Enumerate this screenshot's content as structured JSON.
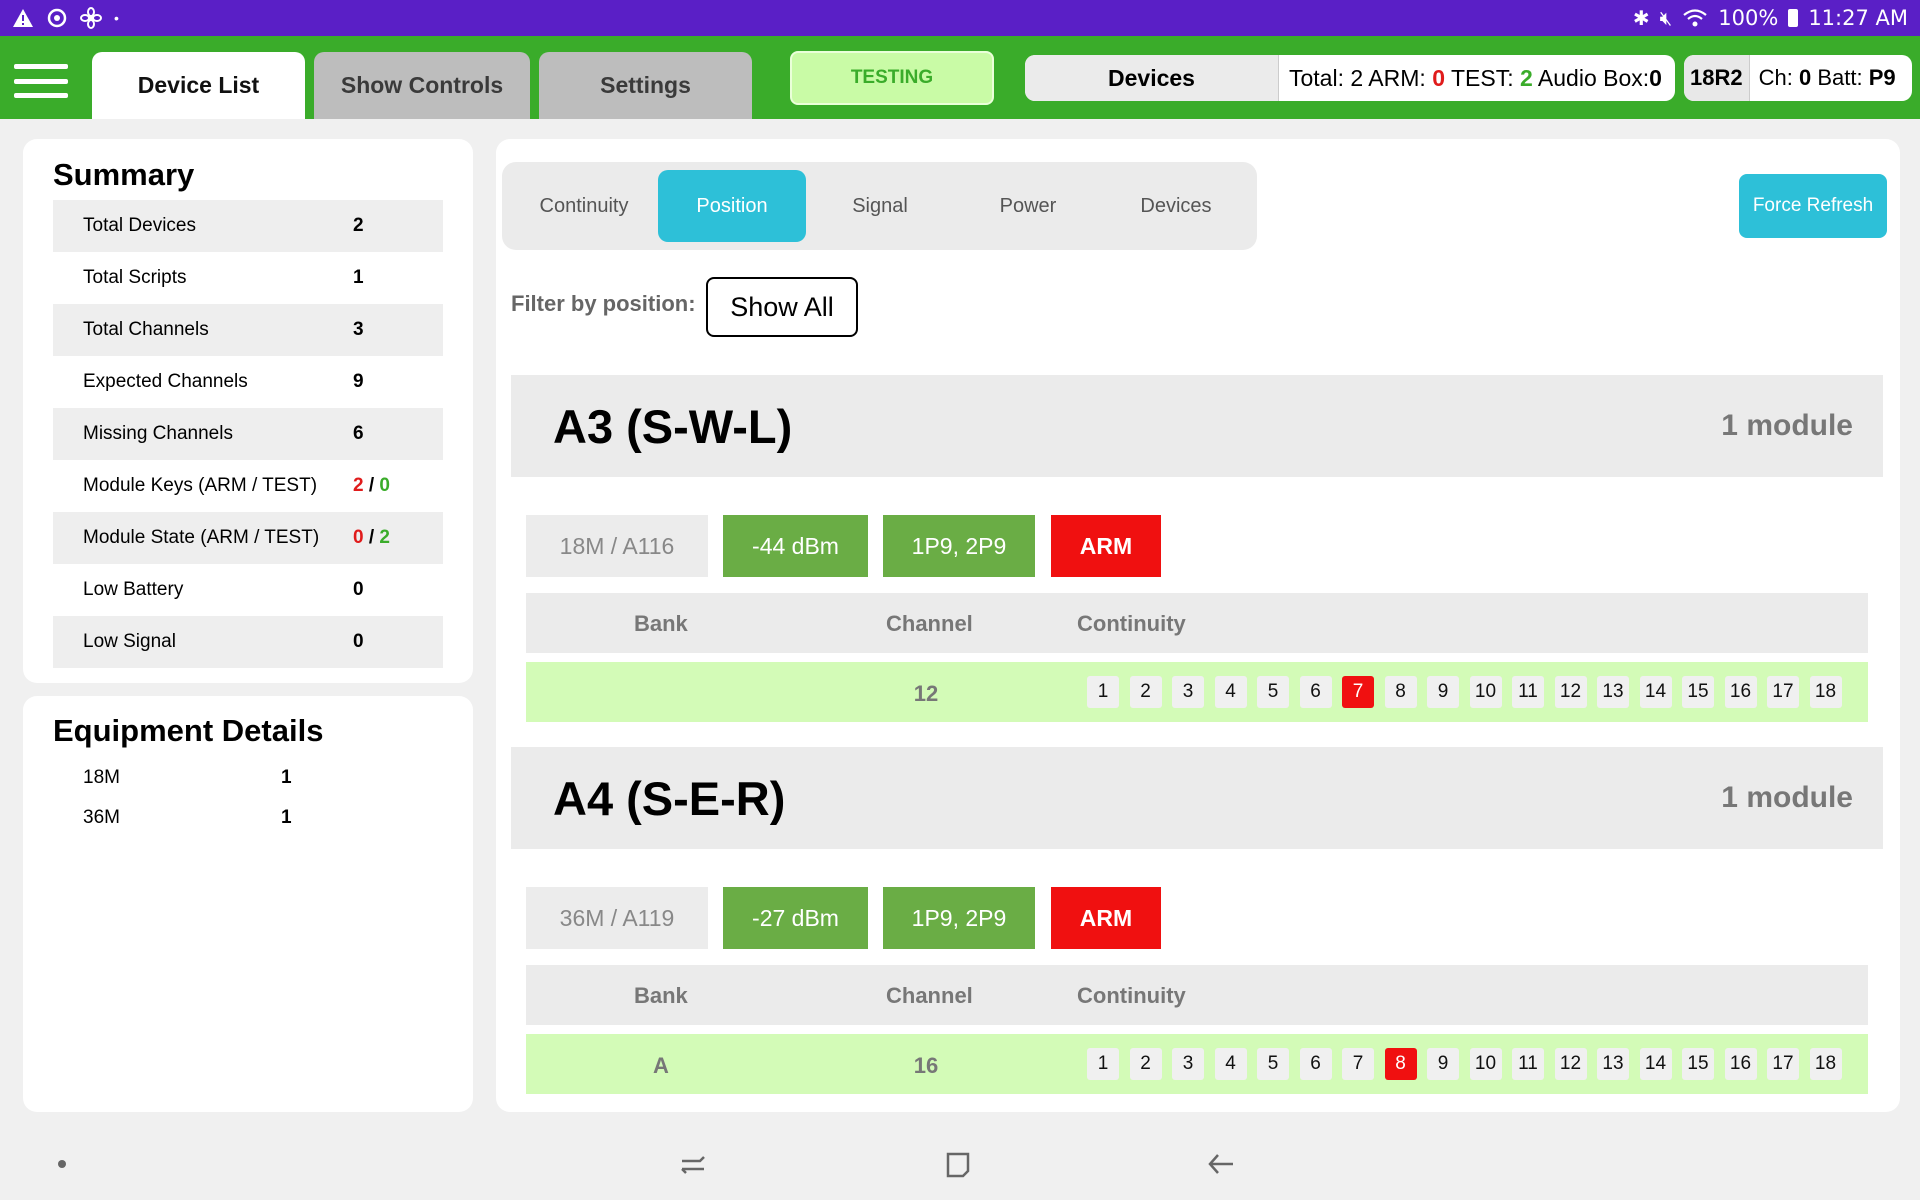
{
  "status_bar": {
    "left_icons": [
      "alert-icon",
      "sync-icon",
      "fan-icon",
      "dot-icon"
    ],
    "battery": "100%",
    "time": "11:27 AM"
  },
  "topbar": {
    "tabs": [
      {
        "label": "Device List",
        "active": true
      },
      {
        "label": "Show Controls",
        "active": false
      },
      {
        "label": "Settings",
        "active": false
      }
    ],
    "testing_label": "TESTING",
    "devices_label": "Devices",
    "devices_stats": {
      "total_label": "Total:",
      "total": "2",
      "arm_label": "ARM:",
      "arm": "0",
      "test_label": "TEST:",
      "test": "2",
      "audio_label": "Audio Box:",
      "audio": "0"
    },
    "radio": {
      "id": "18R2",
      "ch_label": "Ch:",
      "ch": "0",
      "batt_label": "Batt:",
      "batt": "P9"
    }
  },
  "summary": {
    "title": "Summary",
    "rows": [
      {
        "label": "Total Devices",
        "value": "2"
      },
      {
        "label": "Total Scripts",
        "value": "1"
      },
      {
        "label": "Total Channels",
        "value": "3"
      },
      {
        "label": "Expected Channels",
        "value": "9"
      },
      {
        "label": "Missing Channels",
        "value": "6"
      }
    ],
    "keys_row": {
      "label": "Module Keys (ARM / TEST)",
      "arm": "2",
      "sep": " / ",
      "test": "0"
    },
    "state_row": {
      "label": "Module State (ARM / TEST)",
      "arm": "0",
      "sep": " / ",
      "test": "2"
    },
    "low_rows": [
      {
        "label": "Low Battery",
        "value": "0"
      },
      {
        "label": "Low Signal",
        "value": "0"
      }
    ]
  },
  "equipment": {
    "title": "Equipment Details",
    "rows": [
      {
        "label": "18M",
        "value": "1"
      },
      {
        "label": "36M",
        "value": "1"
      }
    ]
  },
  "main": {
    "subtabs": [
      "Continuity",
      "Position",
      "Signal",
      "Power",
      "Devices"
    ],
    "active_subtab": "Position",
    "force_refresh": "Force Refresh",
    "filter_label": "Filter by position:",
    "filter_value": "Show All",
    "table_headers": {
      "bank": "Bank",
      "channel": "Channel",
      "continuity": "Continuity"
    },
    "positions": [
      {
        "name": "A3 (S-W-L)",
        "count": "1 module",
        "module": "18M / A116",
        "signal": "-44 dBm",
        "power": "1P9, 2P9",
        "state": "ARM",
        "bank": "",
        "channel": "12",
        "continuity": [
          "1",
          "2",
          "3",
          "4",
          "5",
          "6",
          "7",
          "8",
          "9",
          "10",
          "11",
          "12",
          "13",
          "14",
          "15",
          "16",
          "17",
          "18"
        ],
        "active_cue": "7"
      },
      {
        "name": "A4 (S-E-R)",
        "count": "1 module",
        "module": "36M / A119",
        "signal": "-27 dBm",
        "power": "1P9, 2P9",
        "state": "ARM",
        "bank": "A",
        "channel": "16",
        "continuity": [
          "1",
          "2",
          "3",
          "4",
          "5",
          "6",
          "7",
          "8",
          "9",
          "10",
          "11",
          "12",
          "13",
          "14",
          "15",
          "16",
          "17",
          "18"
        ],
        "active_cue": "8"
      }
    ]
  },
  "colors": {
    "status_bar": "#5a1fc6",
    "app_bar": "#3aac2a",
    "accent": "#2dc0d8",
    "arm_red": "#f01010",
    "row_green": "#d3fbb7",
    "chip_green": "#6aad45"
  },
  "navbar": {
    "icons": [
      "menu-dot-icon",
      "recent-apps-icon",
      "home-icon",
      "back-icon"
    ]
  }
}
